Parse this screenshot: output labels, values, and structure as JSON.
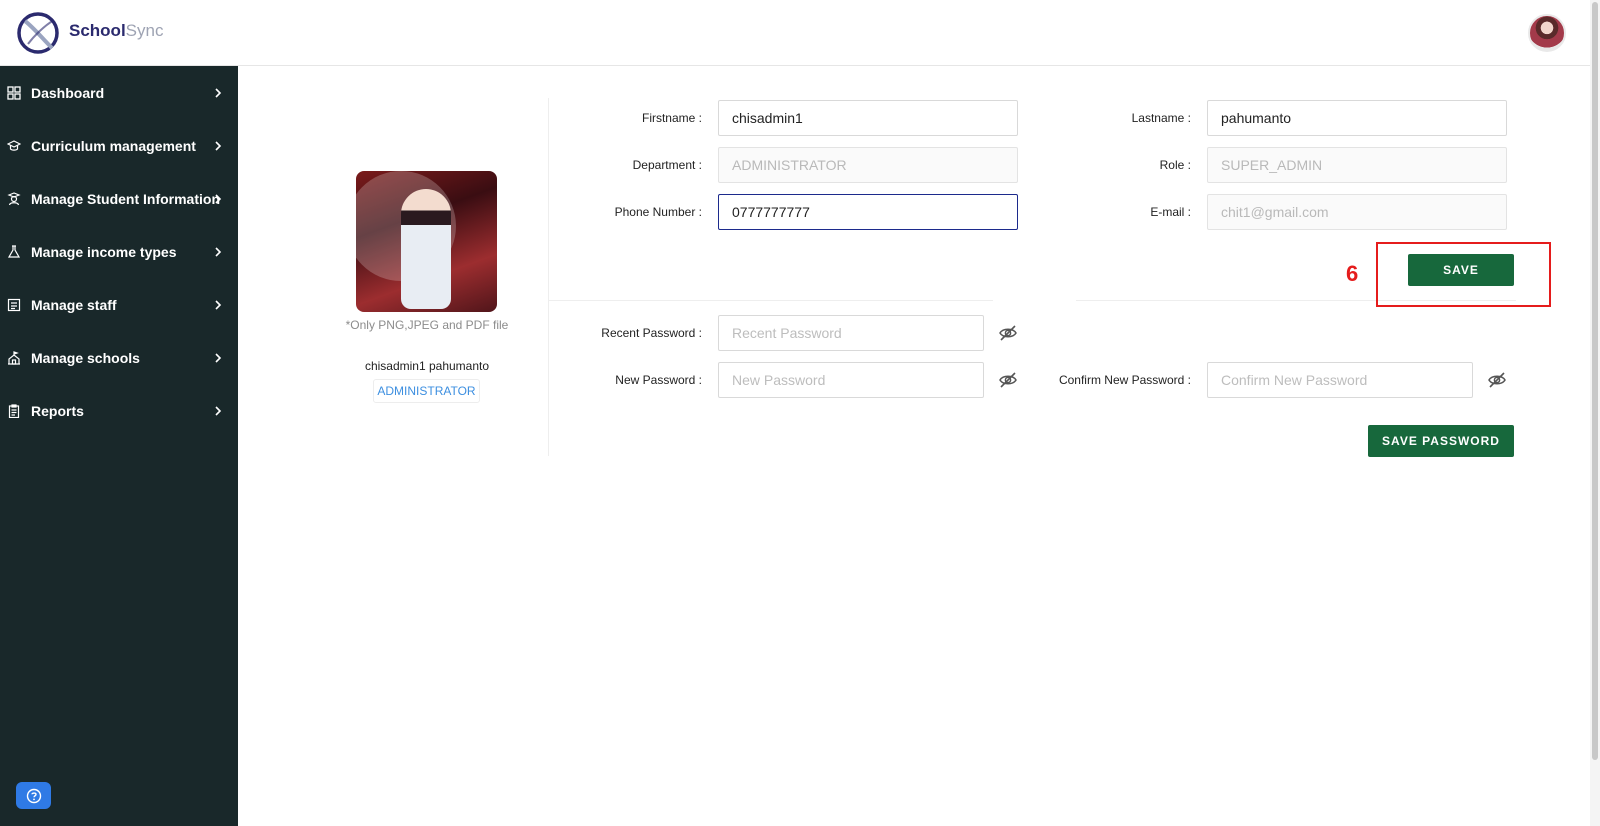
{
  "app": {
    "brand_first": "School",
    "brand_second": "Sync"
  },
  "sidebar": {
    "items": [
      {
        "label": "Dashboard",
        "icon": "grid-icon"
      },
      {
        "label": "Curriculum management",
        "icon": "graduation-cap-icon"
      },
      {
        "label": "Manage Student Information",
        "icon": "student-icon"
      },
      {
        "label": "Manage income types",
        "icon": "flask-icon"
      },
      {
        "label": "Manage staff",
        "icon": "staff-card-icon"
      },
      {
        "label": "Manage schools",
        "icon": "school-icon"
      },
      {
        "label": "Reports",
        "icon": "clipboard-icon"
      }
    ],
    "help_icon": "question-icon"
  },
  "profile": {
    "file_hint": "*Only PNG,JPEG and PDF file",
    "name": "chisadmin1 pahumanto",
    "role": "ADMINISTRATOR"
  },
  "form": {
    "firstname": {
      "label": "Firstname :",
      "value": "chisadmin1"
    },
    "lastname": {
      "label": "Lastname :",
      "value": "pahumanto"
    },
    "department": {
      "label": "Department :",
      "value": "ADMINISTRATOR"
    },
    "role": {
      "label": "Role :",
      "value": "SUPER_ADMIN"
    },
    "phone": {
      "label": "Phone Number :",
      "value": "0777777777"
    },
    "email": {
      "label": "E-mail :",
      "value": "chit1@gmail.com"
    },
    "save_label": "SAVE"
  },
  "password": {
    "recent": {
      "label": "Recent Password :",
      "placeholder": "Recent Password"
    },
    "new": {
      "label": "New Password :",
      "placeholder": "New Password"
    },
    "confirm": {
      "label": "Confirm New Password :",
      "placeholder": "Confirm New Password"
    },
    "save_label": "SAVE PASSWORD"
  },
  "annotation": {
    "number": "6",
    "color": "#e51c1c"
  },
  "colors": {
    "sidebar": "#19282a",
    "primary_button": "#17683c",
    "focus": "#1c2a8c",
    "badge_text": "#3d8fe0"
  }
}
